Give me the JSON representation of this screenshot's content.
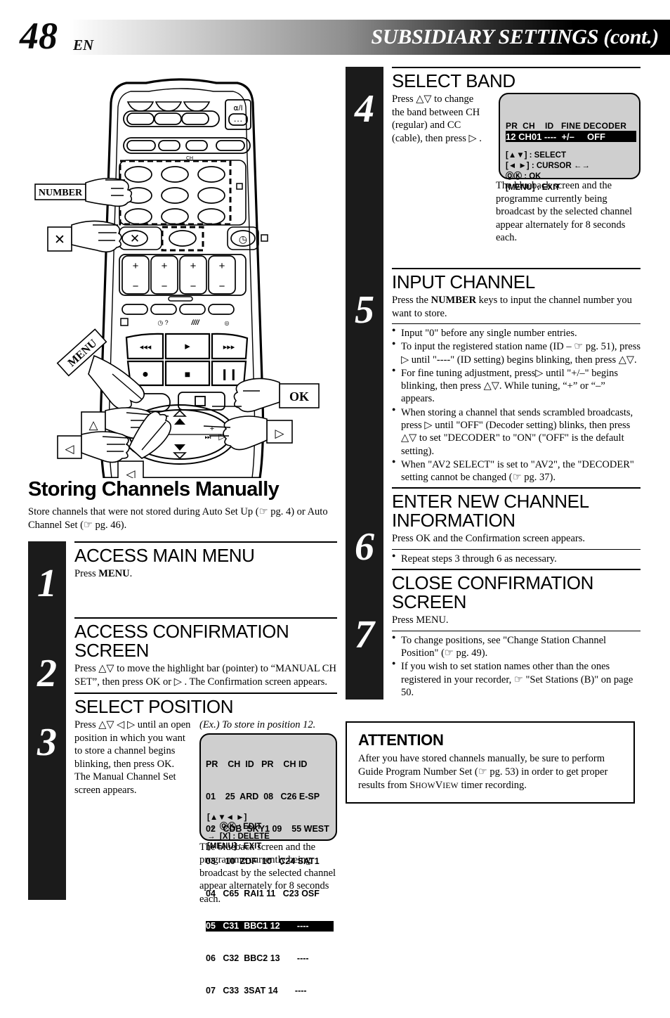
{
  "header": {
    "page_number": "48",
    "language_code": "EN",
    "title": "SUBSIDIARY SETTINGS (cont.)"
  },
  "remote": {
    "callouts": [
      {
        "name": "number",
        "label": "NUMBER"
      },
      {
        "name": "cancel",
        "label": "X"
      },
      {
        "name": "menu",
        "label": "MENU"
      },
      {
        "name": "ok",
        "label": "OK"
      },
      {
        "name": "up",
        "label": "△"
      },
      {
        "name": "down",
        "label": "◁"
      },
      {
        "name": "left",
        "label": "◁"
      },
      {
        "name": "right",
        "label": "▷"
      }
    ],
    "power_icon": "power-icon"
  },
  "section": {
    "title": "Storing Channels Manually",
    "intro": "Store channels that were not stored during Auto Set Up (☞ pg. 4) or Auto Channel Set (☞ pg. 46)."
  },
  "steps_left": [
    {
      "number": "1",
      "heading": "ACCESS MAIN MENU",
      "body_pre": "Press ",
      "body_bold": "MENU",
      "body_post": "."
    },
    {
      "number": "2",
      "heading": "ACCESS CONFIRMATION SCREEN",
      "text": "Press △▽ to move the highlight bar (pointer) to “MANUAL CH SET”, then press OK or ▷ . The Confirmation screen appears."
    },
    {
      "number": "3",
      "heading": "SELECT POSITION",
      "text": "Press △▽ ◁ ▷ until an open position in which you want to store a channel begins blinking, then press OK. The Manual Channel Set screen appears."
    }
  ],
  "example_caption": "(Ex.) To store in position 12.",
  "channel_list_screen": {
    "columns": [
      "PR",
      "CH",
      "ID",
      "PR",
      "CH",
      "ID"
    ],
    "rows": [
      {
        "pr": "01",
        "ch": "25",
        "id": "ARD",
        "pr2": "08",
        "ch2": "C26",
        "id2": "E-SP",
        "highlighted": false
      },
      {
        "pr": "02",
        "ch": "CDB",
        "id": "SKY1",
        "pr2": "09",
        "ch2": "55",
        "id2": "WEST",
        "highlighted": false
      },
      {
        "pr": "03",
        "ch": "10",
        "id": "ZDF",
        "pr2": "10",
        "ch2": "C24",
        "id2": "SAT1",
        "highlighted": false
      },
      {
        "pr": "04",
        "ch": "C65",
        "id": "RAI1",
        "pr2": "11",
        "ch2": "C23",
        "id2": "OSF",
        "highlighted": false
      },
      {
        "pr": "05",
        "ch": "C31",
        "id": "BBC1",
        "pr2": "12",
        "ch2": "",
        "id2": "----",
        "highlighted": true
      },
      {
        "pr": "06",
        "ch": "C32",
        "id": "BBC2",
        "pr2": "13",
        "ch2": "",
        "id2": "----",
        "highlighted": false
      },
      {
        "pr": "07",
        "ch": "C33",
        "id": "3SAT",
        "pr2": "14",
        "ch2": "",
        "id2": "----",
        "highlighted": false
      }
    ],
    "hints": [
      "[▲▼◄ ►]",
      "→  ⓄⓀ : EDIT",
      "→  [X] : DELETE",
      "[MENU] : EXIT"
    ]
  },
  "bluebck_caption": "The blueback screen and the programme currently being broadcast by the selected channel appear alternately for 8 seconds each.",
  "steps_right": [
    {
      "number": "4",
      "heading": "SELECT BAND",
      "text": "Press △▽ to change the band between CH (regular) and CC (cable), then press ▷ ."
    },
    {
      "number": "5",
      "heading": "INPUT CHANNEL",
      "text_pre": "Press the ",
      "text_bold": "NUMBER",
      "text_post": " keys to input the channel number you want to store.",
      "bullets": [
        "Input \"0\" before any single number entries.",
        "To input the registered station name (ID – ☞ pg. 51), press ▷ until \"----\" (ID setting) begins blinking, then press △▽.",
        "For fine tuning adjustment, press▷ until \"+/–\" begins blinking, then press  △▽. While tuning, “+” or “–” appears.",
        "When storing a channel that sends scrambled broadcasts, press  ▷ until \"OFF\" (Decoder setting) blinks, then press △▽ to set \"DECODER\" to \"ON\" (\"OFF\" is the default setting).",
        "When \"AV2 SELECT\" is set to \"AV2\", the \"DECODER\" setting cannot be changed (☞ pg. 37)."
      ]
    },
    {
      "number": "6",
      "heading": "ENTER NEW CHANNEL INFORMATION",
      "text": "Press OK and the Confirmation screen appears.",
      "bullets": [
        "Repeat steps 3 through 6 as necessary."
      ]
    },
    {
      "number": "7",
      "heading": "CLOSE CONFIRMATION SCREEN",
      "text": "Press MENU.",
      "bullets": [
        "To change positions, see \"Change Station Channel Position\" (☞ pg. 49).",
        "If you wish to set station names other than the ones registered in your recorder, ☞ \"Set Stations (B)\" on page 50."
      ]
    }
  ],
  "band_screen": {
    "header_line": "PR  CH    ID   FINE DECODER",
    "value_line": "12 CH01 ----  +/–     OFF",
    "hints": [
      "[▲▼] : SELECT",
      "[◄ ►] : CURSOR ←→",
      "ⓄⓀ : OK",
      "[MENU] : EXIT"
    ]
  },
  "attention": {
    "title": "ATTENTION",
    "text_a": "After you have stored channels manually, be sure to perform Guide Program Number Set (☞ pg. 53) in order to get proper results from S",
    "text_sc1": "HOW",
    "text_b": "V",
    "text_sc2": "IEW",
    "text_c": " timer recording."
  },
  "colors": {
    "step_bar": "#1b1b1b",
    "screen_bg": "#cfcfcf",
    "highlight": "#000000"
  }
}
